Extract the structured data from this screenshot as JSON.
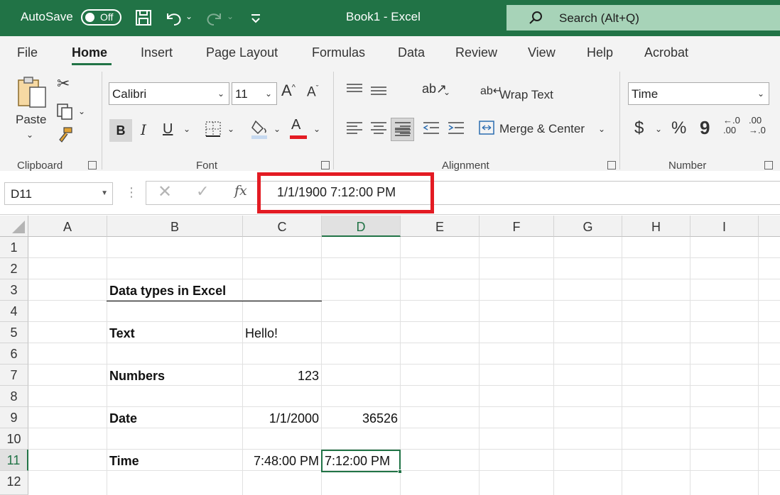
{
  "titlebar": {
    "autosave_label": "AutoSave",
    "autosave_state": "Off",
    "title": "Book1  -  Excel",
    "search_placeholder": "Search (Alt+Q)"
  },
  "ribbon": {
    "tabs": [
      "File",
      "Home",
      "Insert",
      "Page Layout",
      "Formulas",
      "Data",
      "Review",
      "View",
      "Help",
      "Acrobat"
    ],
    "active_tab": "Home",
    "clipboard": {
      "paste_label": "Paste",
      "group_label": "Clipboard"
    },
    "font": {
      "font_name": "Calibri",
      "font_size": "11",
      "group_label": "Font",
      "bold": "B",
      "italic": "I",
      "underline": "U"
    },
    "alignment": {
      "wrap_text": "Wrap Text",
      "merge_center": "Merge & Center",
      "group_label": "Alignment"
    },
    "number": {
      "format": "Time",
      "currency": "$",
      "percent": "%",
      "comma": "9",
      "group_label": "Number"
    }
  },
  "formula_bar": {
    "name_box": "D11",
    "value": "1/1/1900  7:12:00 PM"
  },
  "grid": {
    "columns": [
      "A",
      "B",
      "C",
      "D",
      "E",
      "F",
      "G",
      "H",
      "I"
    ],
    "selected_column": "D",
    "rows": [
      "1",
      "2",
      "3",
      "4",
      "5",
      "6",
      "7",
      "8",
      "9",
      "10",
      "11",
      "12"
    ],
    "selected_row": "11",
    "cells": {
      "B3": "Data types in Excel",
      "B5": "Text",
      "C5": "Hello!",
      "B7": "Numbers",
      "C7": "123",
      "B9": "Date",
      "C9": "1/1/2000",
      "D9": "36526",
      "B11": "Time",
      "C11": "7:48:00 PM",
      "D11": "7:12:00 PM"
    },
    "accent_color": "#217346",
    "highlight_color": "#e31b23"
  }
}
